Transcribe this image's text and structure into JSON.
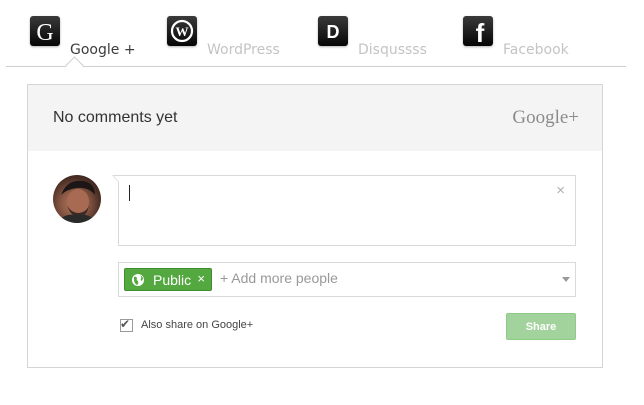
{
  "tabs": [
    {
      "label": "Google +",
      "icon": "google-g-icon",
      "active": true
    },
    {
      "label": "WordPress",
      "icon": "wordpress-icon",
      "active": false
    },
    {
      "label": "Disqussss",
      "icon": "disqus-icon",
      "active": false
    },
    {
      "label": "Facebook",
      "icon": "facebook-icon",
      "active": false
    }
  ],
  "panel": {
    "heading": "No comments yet",
    "brand": "Google+",
    "editor": {
      "value": "",
      "close_glyph": "×"
    },
    "share": {
      "chip_label": "Public",
      "chip_remove": "×",
      "placeholder": "+ Add more people"
    },
    "also_share_label": "Also share on Google+",
    "also_share_checked": true,
    "share_button": "Share"
  },
  "colors": {
    "chip_green": "#53a93f",
    "share_button_disabled": "#a3d39c",
    "header_bg": "#f4f4f4"
  }
}
